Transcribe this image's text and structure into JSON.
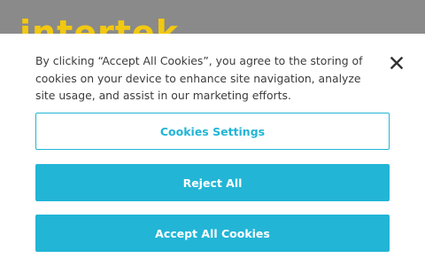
{
  "brand": {
    "logo_text": "intertek"
  },
  "cookie_banner": {
    "message": "By clicking “Accept All Cookies”, you agree to the storing of cookies on your device to enhance site navigation, analyze site usage, and assist in our marketing efforts.",
    "close_icon": "close-icon",
    "buttons": {
      "settings_label": "Cookies Settings",
      "reject_label": "Reject All",
      "accept_label": "Accept All Cookies"
    }
  },
  "colors": {
    "accent": "#22b5d6",
    "logo": "#f2c811",
    "backdrop": "#8a8a8a",
    "text": "#3c3c3c"
  }
}
